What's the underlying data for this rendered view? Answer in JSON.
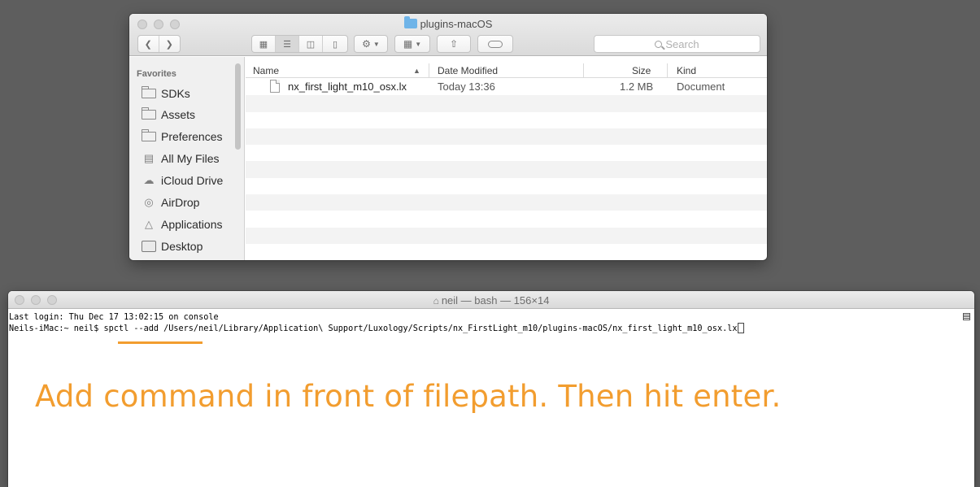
{
  "finder": {
    "title": "plugins-macOS",
    "search_placeholder": "Search",
    "sidebar": {
      "heading": "Favorites",
      "items": [
        {
          "label": "SDKs",
          "icon": "folder-icon"
        },
        {
          "label": "Assets",
          "icon": "folder-icon"
        },
        {
          "label": "Preferences",
          "icon": "folder-icon"
        },
        {
          "label": "All My Files",
          "icon": "all-files-icon"
        },
        {
          "label": "iCloud Drive",
          "icon": "cloud-icon"
        },
        {
          "label": "AirDrop",
          "icon": "airdrop-icon"
        },
        {
          "label": "Applications",
          "icon": "applications-icon"
        },
        {
          "label": "Desktop",
          "icon": "desktop-icon"
        }
      ]
    },
    "columns": {
      "name": "Name",
      "date_modified": "Date Modified",
      "size": "Size",
      "kind": "Kind"
    },
    "files": [
      {
        "name": "nx_first_light_m10_osx.lx",
        "date_modified": "Today 13:36",
        "size": "1.2 MB",
        "kind": "Document"
      }
    ]
  },
  "terminal": {
    "title": "neil — bash — 156×14",
    "lines": [
      "Last login: Thu Dec 17 13:02:15 on console",
      "Neils-iMac:~ neil$ spctl --add /Users/neil/Library/Application\\ Support/Luxology/Scripts/nx_FirstLight_m10/plugins-macOS/nx_first_light_m10_osx.lx"
    ],
    "annotation": "Add command in front of filepath. Then hit enter.",
    "annotation_color": "#f29d2f"
  }
}
